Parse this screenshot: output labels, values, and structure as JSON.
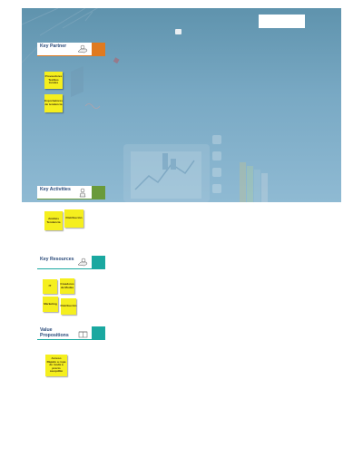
{
  "sections": {
    "key_partner": {
      "title": "Key Partner",
      "accent": "#e07a1f",
      "notes": [
        "Proveedores Textiles locales",
        "Exportadores de tendencia"
      ]
    },
    "key_activities": {
      "title": "Key Activities",
      "accent": "#6a9a3a",
      "notes": [
        "Análisis Tendencia",
        "Distribución"
      ]
    },
    "key_resources": {
      "title": "Key Resources",
      "accent": "#1aa8a0",
      "notes": [
        "IT",
        "Creadores de Modas",
        "Marketing",
        "Distribución"
      ]
    },
    "value_propositions": {
      "title": "Value Propositions",
      "accent": "#1aa8a0",
      "notes": [
        "Acceso Rápido a ropa de moda a precio asequible"
      ]
    }
  },
  "colors": {
    "hero_top": "#5f93ad",
    "hero_bottom": "#8fbad3",
    "note": "#f5ef1e",
    "title_text": "#2a4a7a"
  }
}
